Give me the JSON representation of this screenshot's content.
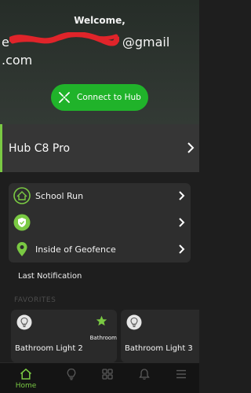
{
  "header": {
    "welcome": "Welcome,",
    "email_visible": "e",
    "email_suffix": "@gmail",
    "email_line2": ".com",
    "connect_label": "Connect to Hub"
  },
  "hub": {
    "name": "Hub C8 Pro"
  },
  "status": {
    "items": [
      {
        "label": "School Run",
        "icon": "home-mode-icon"
      },
      {
        "label": "",
        "icon": "shield-check-icon"
      },
      {
        "label": "Inside of Geofence",
        "icon": "location-pin-icon"
      }
    ]
  },
  "notifications": {
    "title": "Last Notification"
  },
  "favorites": {
    "label": "FAVORITES",
    "devices": [
      {
        "name": "Bathroom Light 2",
        "tag": "Bathroom",
        "starred": true
      },
      {
        "name": "Bathroom Light 3",
        "tag": "",
        "starred": false
      }
    ]
  },
  "nav": {
    "items": [
      {
        "label": "Home",
        "icon": "home-icon",
        "active": true
      },
      {
        "label": "",
        "icon": "bulb-icon",
        "active": false
      },
      {
        "label": "",
        "icon": "grid-icon",
        "active": false
      },
      {
        "label": "",
        "icon": "bell-icon",
        "active": false
      },
      {
        "label": "",
        "icon": "menu-icon",
        "active": false
      }
    ]
  },
  "colors": {
    "accent_green": "#7ac943",
    "button_green": "#20b32a",
    "background": "#1e1e1e",
    "redaction_red": "#e0242a"
  }
}
